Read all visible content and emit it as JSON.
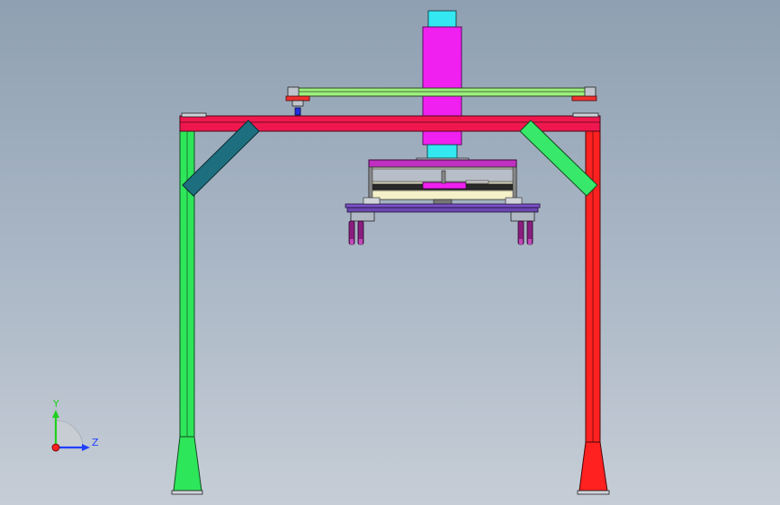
{
  "colors": {
    "background_top": "#8fa0b2",
    "background_bottom": "#c6cdd6",
    "beam_red": "#f0174f",
    "frame_green": "#2ee65a",
    "frame_red": "#ff2020",
    "column_magenta": "#f020f0",
    "column_cyan": "#33e8f0",
    "brace_teal": "#1d6f80",
    "brace_green": "#38e86a",
    "rail_green": "#9cef7c",
    "pad_red": "#f03030",
    "platform_purple": "#c030c0",
    "plate_violet": "#7a52c8",
    "gripper_purple": "#8a1e7e",
    "axis_x": "#ff2020",
    "axis_y": "#20d020",
    "axis_z": "#2040ff"
  },
  "view_triad": {
    "y_label": "Y",
    "z_label": "Z"
  },
  "model": {
    "components": [
      "gantry-frame",
      "top-cross-beam",
      "left-leg",
      "right-leg",
      "left-brace",
      "right-brace",
      "linear-rail",
      "vertical-column",
      "carriage-platform",
      "end-effector-plate",
      "gripper-fingers"
    ]
  }
}
